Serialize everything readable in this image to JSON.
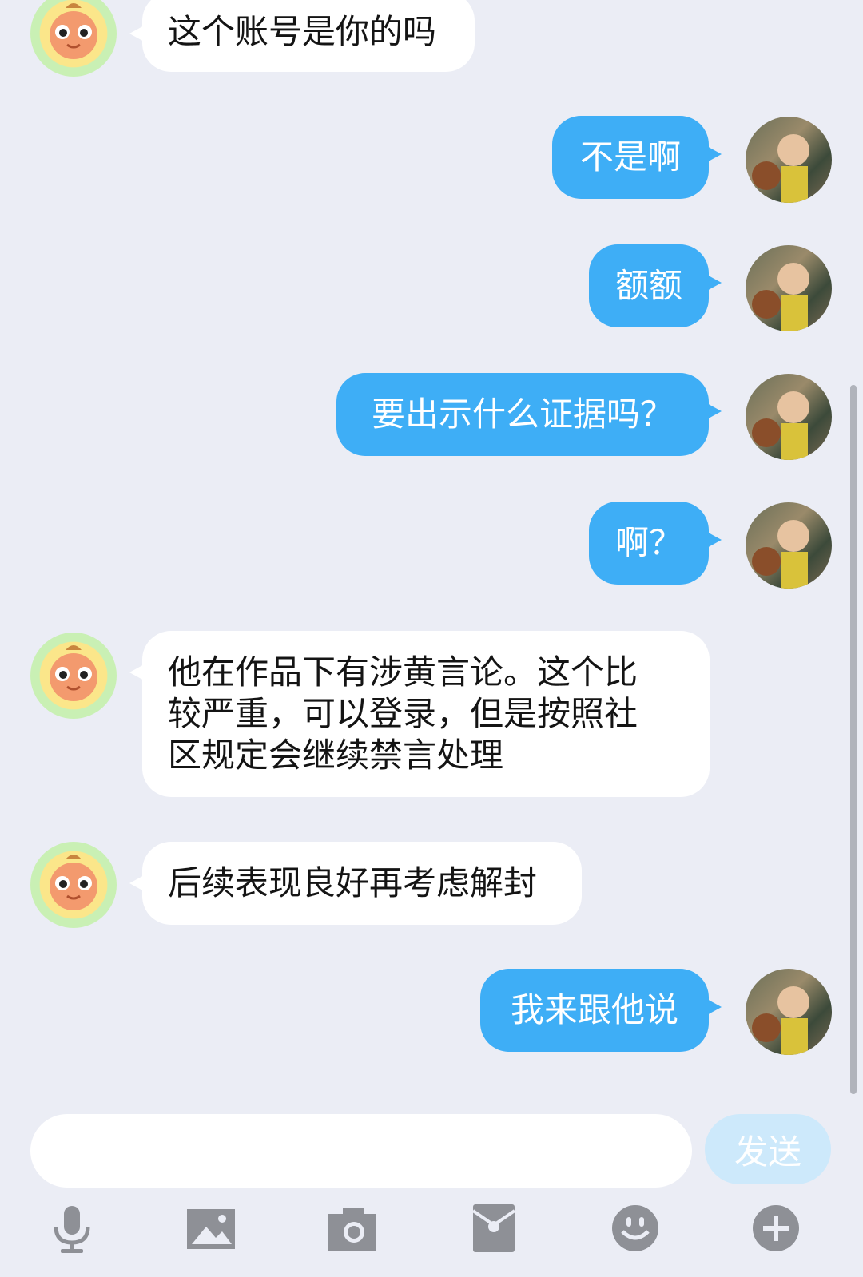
{
  "messages": [
    {
      "side": "in",
      "text": "这个账号是你的吗"
    },
    {
      "side": "out",
      "text": "不是啊"
    },
    {
      "side": "out",
      "text": "额额"
    },
    {
      "side": "out",
      "text": "要出示什么证据吗？"
    },
    {
      "side": "out",
      "text": "啊？"
    },
    {
      "side": "in",
      "lines": [
        "他在作品下有涉黄言论。这个比",
        "较严重，可以登录，但是按照社",
        "区规定会继续禁言处理"
      ]
    },
    {
      "side": "in",
      "text": "后续表现良好再考虑解封"
    },
    {
      "side": "out",
      "text": "我来跟他说"
    }
  ],
  "composer": {
    "placeholder": "",
    "send_label": "发送"
  },
  "toolbar": {
    "icons": [
      "microphone-icon",
      "image-icon",
      "camera-icon",
      "red-packet-icon",
      "emoji-icon",
      "plus-icon"
    ]
  },
  "colors": {
    "background": "#ebedf5",
    "outgoing_bubble": "#3eaef6",
    "incoming_bubble": "#ffffff",
    "send_button": "#cde9fb",
    "icon_gray": "#8e9096"
  }
}
